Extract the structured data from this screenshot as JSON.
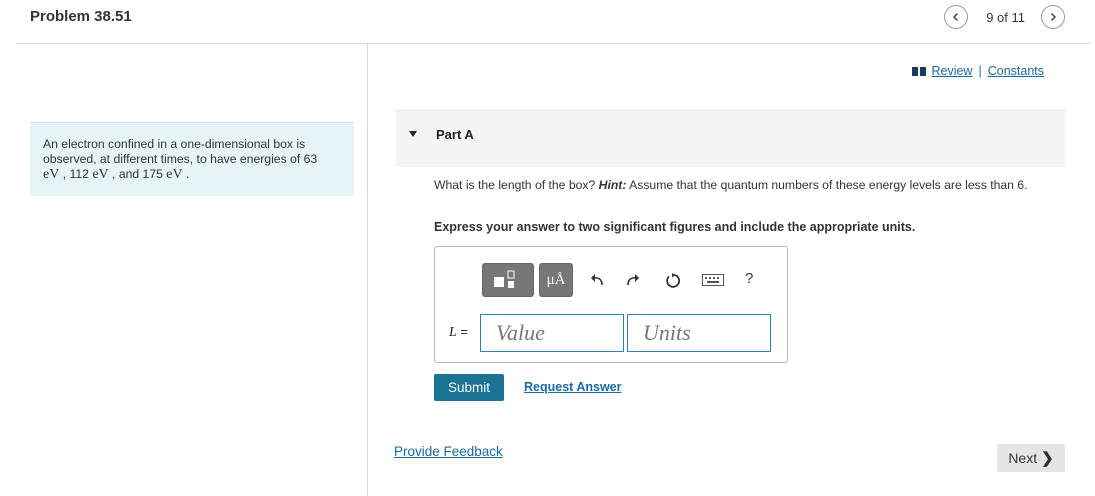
{
  "header": {
    "title": "Problem 38.51",
    "pager_text": "9 of 11"
  },
  "links": {
    "review": "Review",
    "separator": "|",
    "constants": "Constants"
  },
  "problem": {
    "text_a": "An electron confined in a one-dimensional box is observed, at different times, to have energies of 63",
    "unit_ev": "eV",
    "sep1": " , ",
    "val_112": "112",
    "sep2": " , and ",
    "val_175": "175",
    "end": " ."
  },
  "part": {
    "label": "Part A"
  },
  "question": {
    "text": "What is the length of the box?",
    "hint_label": "Hint:",
    "hint_text": "Assume that the quantum numbers of these energy levels are less than 6.",
    "instruction": "Express your answer to two significant figures and include the appropriate units."
  },
  "answer": {
    "units_symbol": "μÅ",
    "help": "?",
    "variable": "L",
    "equals": " =",
    "value_placeholder": "Value",
    "units_placeholder": "Units"
  },
  "actions": {
    "submit": "Submit",
    "request_answer": "Request Answer",
    "provide_feedback": "Provide Feedback",
    "next": "Next",
    "next_chevron": "❯"
  },
  "colors": {
    "accent": "#1b7394",
    "link": "#1a6aa0",
    "problem_bg": "#e6f4f7"
  }
}
